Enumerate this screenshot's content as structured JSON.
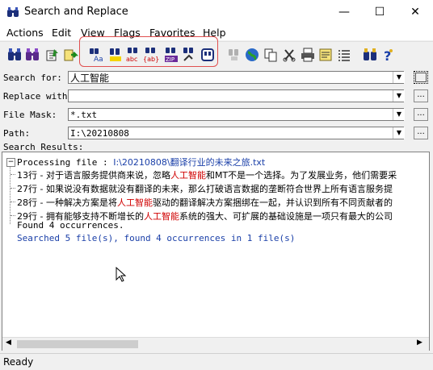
{
  "window": {
    "title": "Search and Replace",
    "minimize": "—",
    "maximize": "☐",
    "close": "✕"
  },
  "menu": [
    "Actions",
    "Edit",
    "View",
    "Flags",
    "Favorites",
    "Help"
  ],
  "toolbar": {
    "icons": [
      "find-icon",
      "find-in-files-icon",
      "open-folder-icon",
      "go-icon",
      "search-case-icon",
      "search-highlight-icon",
      "search-abc-icon",
      "search-regex-icon",
      "search-zip-icon",
      "search-replace-icon",
      "search-binary-icon",
      "disabled-icon",
      "globe-icon",
      "copy-icon",
      "delete-icon",
      "print-icon",
      "notes-icon",
      "list-icon",
      "binoculars-icon",
      "help-icon"
    ],
    "box_color": "#e05050"
  },
  "form": {
    "search_label": "Search for:",
    "search_value": "人工智能",
    "replace_label": "Replace with:",
    "replace_value": "",
    "mask_label": "File Mask:",
    "mask_value": "*.txt",
    "path_label": "Path:",
    "path_value": "I:\\20210808",
    "browse": "..."
  },
  "results": {
    "label": "Search Results:",
    "processing_prefix": "Processing file : ",
    "processing_path": "I:\\20210808\\翻译行业的未来之旅.txt",
    "lines": [
      {
        "prefix": "13行 - 对于语言服务提供商来说，忽略",
        "match": "人工智能",
        "suffix": "和MT不是一个选择。为了发展业务，他们需要采"
      },
      {
        "prefix": "27行 - 如果说没有数据就没有翻译的未来，那么打破语言数据的垄断符合世界上所有语言服务提",
        "match": "",
        "suffix": ""
      },
      {
        "prefix": "28行 - 一种解决方案是将",
        "match": "人工智能",
        "suffix": "驱动的翻译解决方案捆绑在一起，并认识到所有不同贡献者的"
      },
      {
        "prefix": "29行 - 拥有能够支持不断增长的",
        "match": "人工智能",
        "suffix": "系统的强大、可扩展的基础设施是一项只有最大的公司"
      }
    ],
    "found": "Found 4 occurrences.",
    "summary": "Searched 5 file(s), found 4 occurrences in 1 file(s)",
    "highlight_color": "#d00000",
    "summary_color": "#1a3fa8"
  },
  "status": "Ready"
}
